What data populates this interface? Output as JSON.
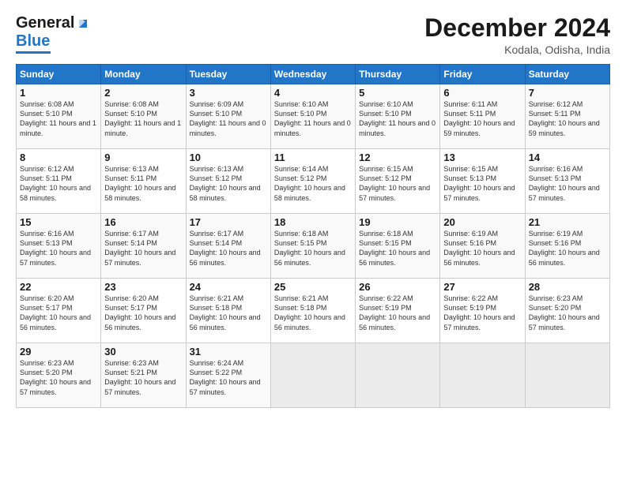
{
  "logo": {
    "line1": "General",
    "line2": "Blue"
  },
  "title": "December 2024",
  "subtitle": "Kodala, Odisha, India",
  "days_of_week": [
    "Sunday",
    "Monday",
    "Tuesday",
    "Wednesday",
    "Thursday",
    "Friday",
    "Saturday"
  ],
  "weeks": [
    [
      {
        "day": "1",
        "sunrise": "6:08 AM",
        "sunset": "5:10 PM",
        "daylight": "11 hours and 1 minute."
      },
      {
        "day": "2",
        "sunrise": "6:08 AM",
        "sunset": "5:10 PM",
        "daylight": "11 hours and 1 minute."
      },
      {
        "day": "3",
        "sunrise": "6:09 AM",
        "sunset": "5:10 PM",
        "daylight": "11 hours and 0 minutes."
      },
      {
        "day": "4",
        "sunrise": "6:10 AM",
        "sunset": "5:10 PM",
        "daylight": "11 hours and 0 minutes."
      },
      {
        "day": "5",
        "sunrise": "6:10 AM",
        "sunset": "5:10 PM",
        "daylight": "11 hours and 0 minutes."
      },
      {
        "day": "6",
        "sunrise": "6:11 AM",
        "sunset": "5:11 PM",
        "daylight": "10 hours and 59 minutes."
      },
      {
        "day": "7",
        "sunrise": "6:12 AM",
        "sunset": "5:11 PM",
        "daylight": "10 hours and 59 minutes."
      }
    ],
    [
      {
        "day": "8",
        "sunrise": "6:12 AM",
        "sunset": "5:11 PM",
        "daylight": "10 hours and 58 minutes."
      },
      {
        "day": "9",
        "sunrise": "6:13 AM",
        "sunset": "5:11 PM",
        "daylight": "10 hours and 58 minutes."
      },
      {
        "day": "10",
        "sunrise": "6:13 AM",
        "sunset": "5:12 PM",
        "daylight": "10 hours and 58 minutes."
      },
      {
        "day": "11",
        "sunrise": "6:14 AM",
        "sunset": "5:12 PM",
        "daylight": "10 hours and 58 minutes."
      },
      {
        "day": "12",
        "sunrise": "6:15 AM",
        "sunset": "5:12 PM",
        "daylight": "10 hours and 57 minutes."
      },
      {
        "day": "13",
        "sunrise": "6:15 AM",
        "sunset": "5:13 PM",
        "daylight": "10 hours and 57 minutes."
      },
      {
        "day": "14",
        "sunrise": "6:16 AM",
        "sunset": "5:13 PM",
        "daylight": "10 hours and 57 minutes."
      }
    ],
    [
      {
        "day": "15",
        "sunrise": "6:16 AM",
        "sunset": "5:13 PM",
        "daylight": "10 hours and 57 minutes."
      },
      {
        "day": "16",
        "sunrise": "6:17 AM",
        "sunset": "5:14 PM",
        "daylight": "10 hours and 57 minutes."
      },
      {
        "day": "17",
        "sunrise": "6:17 AM",
        "sunset": "5:14 PM",
        "daylight": "10 hours and 56 minutes."
      },
      {
        "day": "18",
        "sunrise": "6:18 AM",
        "sunset": "5:15 PM",
        "daylight": "10 hours and 56 minutes."
      },
      {
        "day": "19",
        "sunrise": "6:18 AM",
        "sunset": "5:15 PM",
        "daylight": "10 hours and 56 minutes."
      },
      {
        "day": "20",
        "sunrise": "6:19 AM",
        "sunset": "5:16 PM",
        "daylight": "10 hours and 56 minutes."
      },
      {
        "day": "21",
        "sunrise": "6:19 AM",
        "sunset": "5:16 PM",
        "daylight": "10 hours and 56 minutes."
      }
    ],
    [
      {
        "day": "22",
        "sunrise": "6:20 AM",
        "sunset": "5:17 PM",
        "daylight": "10 hours and 56 minutes."
      },
      {
        "day": "23",
        "sunrise": "6:20 AM",
        "sunset": "5:17 PM",
        "daylight": "10 hours and 56 minutes."
      },
      {
        "day": "24",
        "sunrise": "6:21 AM",
        "sunset": "5:18 PM",
        "daylight": "10 hours and 56 minutes."
      },
      {
        "day": "25",
        "sunrise": "6:21 AM",
        "sunset": "5:18 PM",
        "daylight": "10 hours and 56 minutes."
      },
      {
        "day": "26",
        "sunrise": "6:22 AM",
        "sunset": "5:19 PM",
        "daylight": "10 hours and 56 minutes."
      },
      {
        "day": "27",
        "sunrise": "6:22 AM",
        "sunset": "5:19 PM",
        "daylight": "10 hours and 57 minutes."
      },
      {
        "day": "28",
        "sunrise": "6:23 AM",
        "sunset": "5:20 PM",
        "daylight": "10 hours and 57 minutes."
      }
    ],
    [
      {
        "day": "29",
        "sunrise": "6:23 AM",
        "sunset": "5:20 PM",
        "daylight": "10 hours and 57 minutes."
      },
      {
        "day": "30",
        "sunrise": "6:23 AM",
        "sunset": "5:21 PM",
        "daylight": "10 hours and 57 minutes."
      },
      {
        "day": "31",
        "sunrise": "6:24 AM",
        "sunset": "5:22 PM",
        "daylight": "10 hours and 57 minutes."
      },
      null,
      null,
      null,
      null
    ]
  ],
  "labels": {
    "sunrise": "Sunrise:",
    "sunset": "Sunset:",
    "daylight": "Daylight:"
  }
}
